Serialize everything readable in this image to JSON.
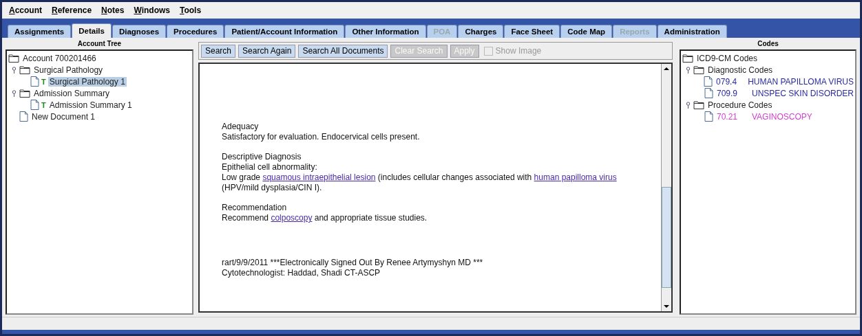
{
  "menu": [
    "Account",
    "Reference",
    "Notes",
    "Windows",
    "Tools"
  ],
  "tabs": [
    {
      "label": "Assignments",
      "selected": false,
      "disabled": false
    },
    {
      "label": "Details",
      "selected": true,
      "disabled": false
    },
    {
      "label": "Diagnoses",
      "selected": false,
      "disabled": false
    },
    {
      "label": "Procedures",
      "selected": false,
      "disabled": false
    },
    {
      "label": "Patient/Account Information",
      "selected": false,
      "disabled": false
    },
    {
      "label": "Other Information",
      "selected": false,
      "disabled": false
    },
    {
      "label": "POA",
      "selected": false,
      "disabled": true
    },
    {
      "label": "Charges",
      "selected": false,
      "disabled": false
    },
    {
      "label": "Face Sheet",
      "selected": false,
      "disabled": false
    },
    {
      "label": "Code Map",
      "selected": false,
      "disabled": false
    },
    {
      "label": "Reports",
      "selected": false,
      "disabled": true
    },
    {
      "label": "Administration",
      "selected": false,
      "disabled": false
    }
  ],
  "account_tree": {
    "title": "Account Tree",
    "root": {
      "kind": "folder",
      "label": "Account 700201466",
      "selected": false,
      "children": [
        {
          "kind": "folder",
          "label": "Surgical Pathology",
          "expanded": true,
          "selected": false,
          "children": [
            {
              "kind": "document",
              "tag": "T",
              "label": "Surgical Pathology 1",
              "selected": true
            }
          ]
        },
        {
          "kind": "folder",
          "label": "Admission Summary",
          "expanded": true,
          "selected": false,
          "children": [
            {
              "kind": "document",
              "tag": "T",
              "label": "Admission Summary 1",
              "selected": false
            }
          ]
        },
        {
          "kind": "document",
          "label": "New Document 1",
          "selected": false
        }
      ]
    }
  },
  "toolbar": {
    "buttons": [
      {
        "label": "Search",
        "disabled": false
      },
      {
        "label": "Search Again",
        "disabled": false
      },
      {
        "label": "Search All Documents",
        "disabled": false
      },
      {
        "label": "Clear Search",
        "disabled": true
      },
      {
        "label": "Apply",
        "disabled": true
      }
    ],
    "show_image": {
      "label": "Show Image",
      "checked": false,
      "disabled": true
    }
  },
  "document": {
    "paragraphs": [
      [
        [
          {
            "text": "Adequacy"
          }
        ],
        [
          {
            "text": "Satisfactory for evaluation. Endocervical cells present."
          }
        ]
      ],
      [
        [
          {
            "text": "Descriptive Diagnosis"
          }
        ],
        [
          {
            "text": "Epithelial cell abnormality:"
          }
        ],
        [
          {
            "text": "Low grade "
          },
          {
            "text": "squamous intraepithelial lesion",
            "link": true
          },
          {
            "text": " (includes cellular changes associated with "
          },
          {
            "text": "human papilloma virus",
            "link": true
          }
        ],
        [
          {
            "text": "(HPV/mild dysplasia/CIN I)."
          }
        ]
      ],
      [
        [
          {
            "text": "Recommendation"
          }
        ],
        [
          {
            "text": "Recommend "
          },
          {
            "text": "colposcopy",
            "link": true
          },
          {
            "text": " and appropriate tissue studies."
          }
        ]
      ],
      [
        [
          {
            "text": "rart/9/9/2011 ***Electronically Signed Out By Renee Artymyshyn MD ***"
          }
        ],
        [
          {
            "text": "Cytotechnologist: Haddad, Shadi CT-ASCP"
          }
        ]
      ]
    ]
  },
  "codes": {
    "title": "Codes",
    "root": {
      "label": "ICD9-CM Codes",
      "groups": [
        {
          "label": "Diagnostic Codes",
          "expanded": true,
          "items": [
            {
              "code": "079.4",
              "description": "HUMAN PAPILLOMA VIRUS",
              "color": "#2a2aa0"
            },
            {
              "code": "709.9",
              "description": "UNSPEC SKIN DISORDER",
              "color": "#2a2aa0"
            }
          ]
        },
        {
          "label": "Procedure Codes",
          "expanded": true,
          "items": [
            {
              "code": "70.21",
              "description": "VAGINOSCOPY",
              "color": "#d040d0"
            }
          ]
        }
      ]
    }
  }
}
